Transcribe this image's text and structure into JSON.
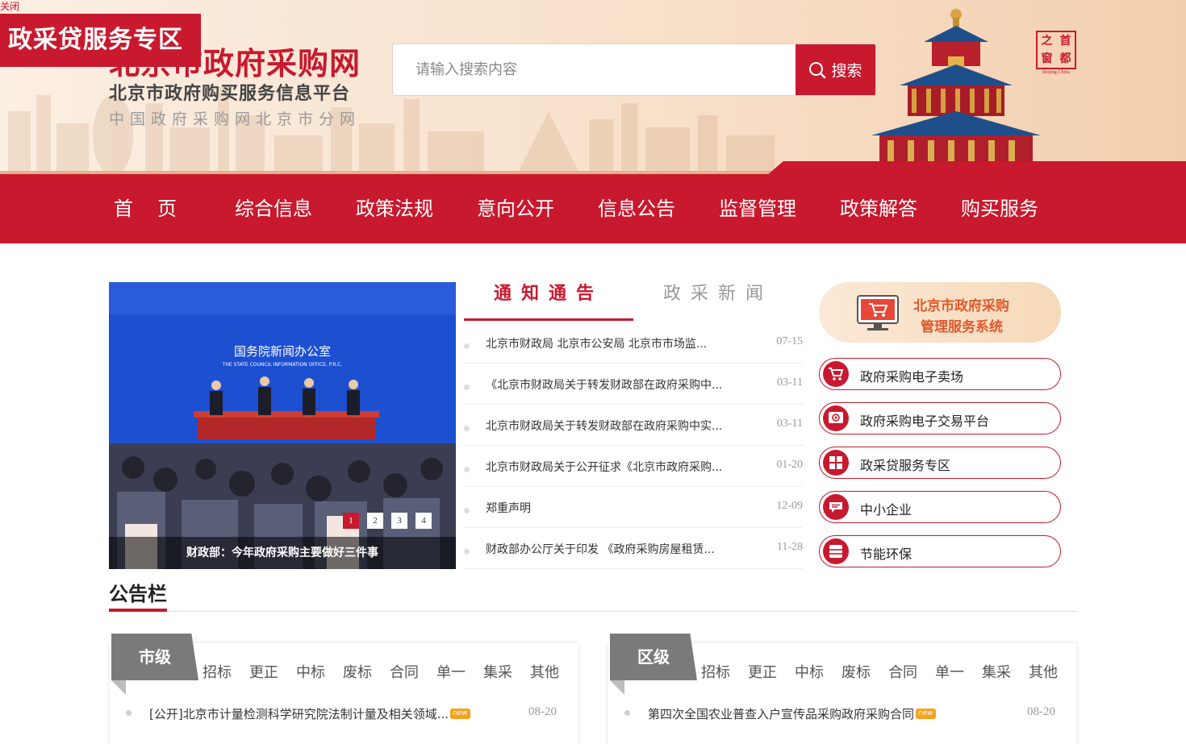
{
  "close_label": "关闭",
  "promo_banner": "政采贷服务专区",
  "site": {
    "title": "北京市政府采购网",
    "subtitle": "北京市政府购买服务信息平台",
    "branch": "中国政府采购网北京市分网"
  },
  "search": {
    "placeholder": "请输入搜索内容",
    "button_label": "搜索"
  },
  "seal": {
    "chars": [
      "之",
      "首",
      "窗",
      "都"
    ],
    "caption": "Beijing-China"
  },
  "nav": [
    "首页",
    "综合信息",
    "政策法规",
    "意向公开",
    "信息公告",
    "监督管理",
    "政策解答",
    "购买服务"
  ],
  "slider": {
    "caption": "财政部：今年政府采购主要做好三件事",
    "backdrop_title": "国务院新闻办公室",
    "backdrop_subtitle": "THE STATE COUNCIL INFORMATION OFFICE, P.R.C.",
    "pages": [
      "1",
      "2",
      "3",
      "4"
    ],
    "active_page": "1"
  },
  "notice": {
    "tabs": [
      "通知通告",
      "政采新闻"
    ],
    "active_tab": "通知通告",
    "items": [
      {
        "title": "北京市财政局 北京市公安局 北京市市场监...",
        "date": "07-15"
      },
      {
        "title": "《北京市财政局关于转发财政部在政府采购中...",
        "date": "03-11"
      },
      {
        "title": "北京市财政局关于转发财政部在政府采购中实...",
        "date": "03-11"
      },
      {
        "title": "北京市财政局关于公开征求《北京市政府采购...",
        "date": "01-20"
      },
      {
        "title": "郑重声明",
        "date": "12-09"
      },
      {
        "title": "财政部办公厅关于印发 《政府采购房屋租赁...",
        "date": "11-28"
      }
    ]
  },
  "system_banner": {
    "line1": "北京市政府采购",
    "line2": "管理服务系统"
  },
  "services": [
    {
      "label": "政府采购电子卖场",
      "icon": "cart-icon"
    },
    {
      "label": "政府采购电子交易平台",
      "icon": "trade-platform-icon"
    },
    {
      "label": "政采贷服务专区",
      "icon": "grid-icon"
    },
    {
      "label": "中小企业",
      "icon": "chat-bubble-icon"
    },
    {
      "label": "节能环保",
      "icon": "cabinet-icon"
    }
  ],
  "bulletin": {
    "title": "公告栏",
    "panels": [
      {
        "badge": "市级",
        "tabs": [
          "招标",
          "更正",
          "中标",
          "废标",
          "合同",
          "单一",
          "集采",
          "其他"
        ],
        "rows": [
          {
            "title": "[公开]北京市计量检测科学研究院法制计量及相关领域...",
            "tag": "new",
            "date": "08-20"
          }
        ]
      },
      {
        "badge": "区级",
        "tabs": [
          "招标",
          "更正",
          "中标",
          "废标",
          "合同",
          "单一",
          "集采",
          "其他"
        ],
        "rows": [
          {
            "title": "第四次全国农业普查入户宣传品采购政府采购合同",
            "tag": "new",
            "date": "08-20"
          }
        ]
      }
    ]
  },
  "colors": {
    "brand_red": "#c8192e",
    "slider_blue": "#1d4fd1",
    "new_tag": "#f4a21c"
  }
}
